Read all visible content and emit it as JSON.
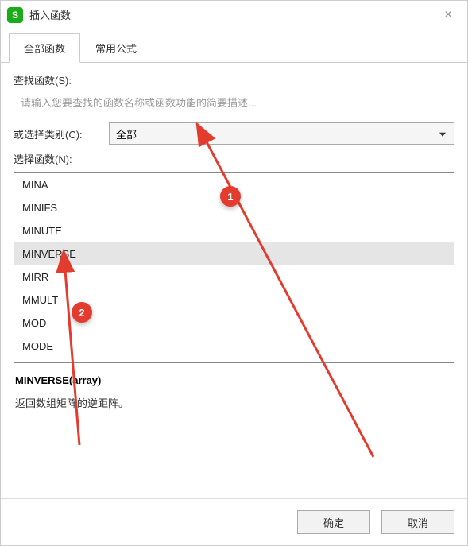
{
  "titlebar": {
    "title": "插入函数",
    "close_icon": "×"
  },
  "tabs": {
    "all_label": "全部函数",
    "common_label": "常用公式"
  },
  "search": {
    "label": "查找函数(S):",
    "placeholder": "请输入您要查找的函数名称或函数功能的简要描述..."
  },
  "category": {
    "label": "或选择类别(C):",
    "selected": "全部"
  },
  "functions": {
    "label": "选择函数(N):",
    "selected_index": 3,
    "items": [
      "MINA",
      "MINIFS",
      "MINUTE",
      "MINVERSE",
      "MIRR",
      "MMULT",
      "MOD",
      "MODE"
    ]
  },
  "description": {
    "syntax": "MINVERSE(array)",
    "text": "返回数组矩阵的逆距阵。"
  },
  "footer": {
    "ok_label": "确定",
    "cancel_label": "取消"
  },
  "annotations": {
    "badge1": "1",
    "badge2": "2"
  }
}
